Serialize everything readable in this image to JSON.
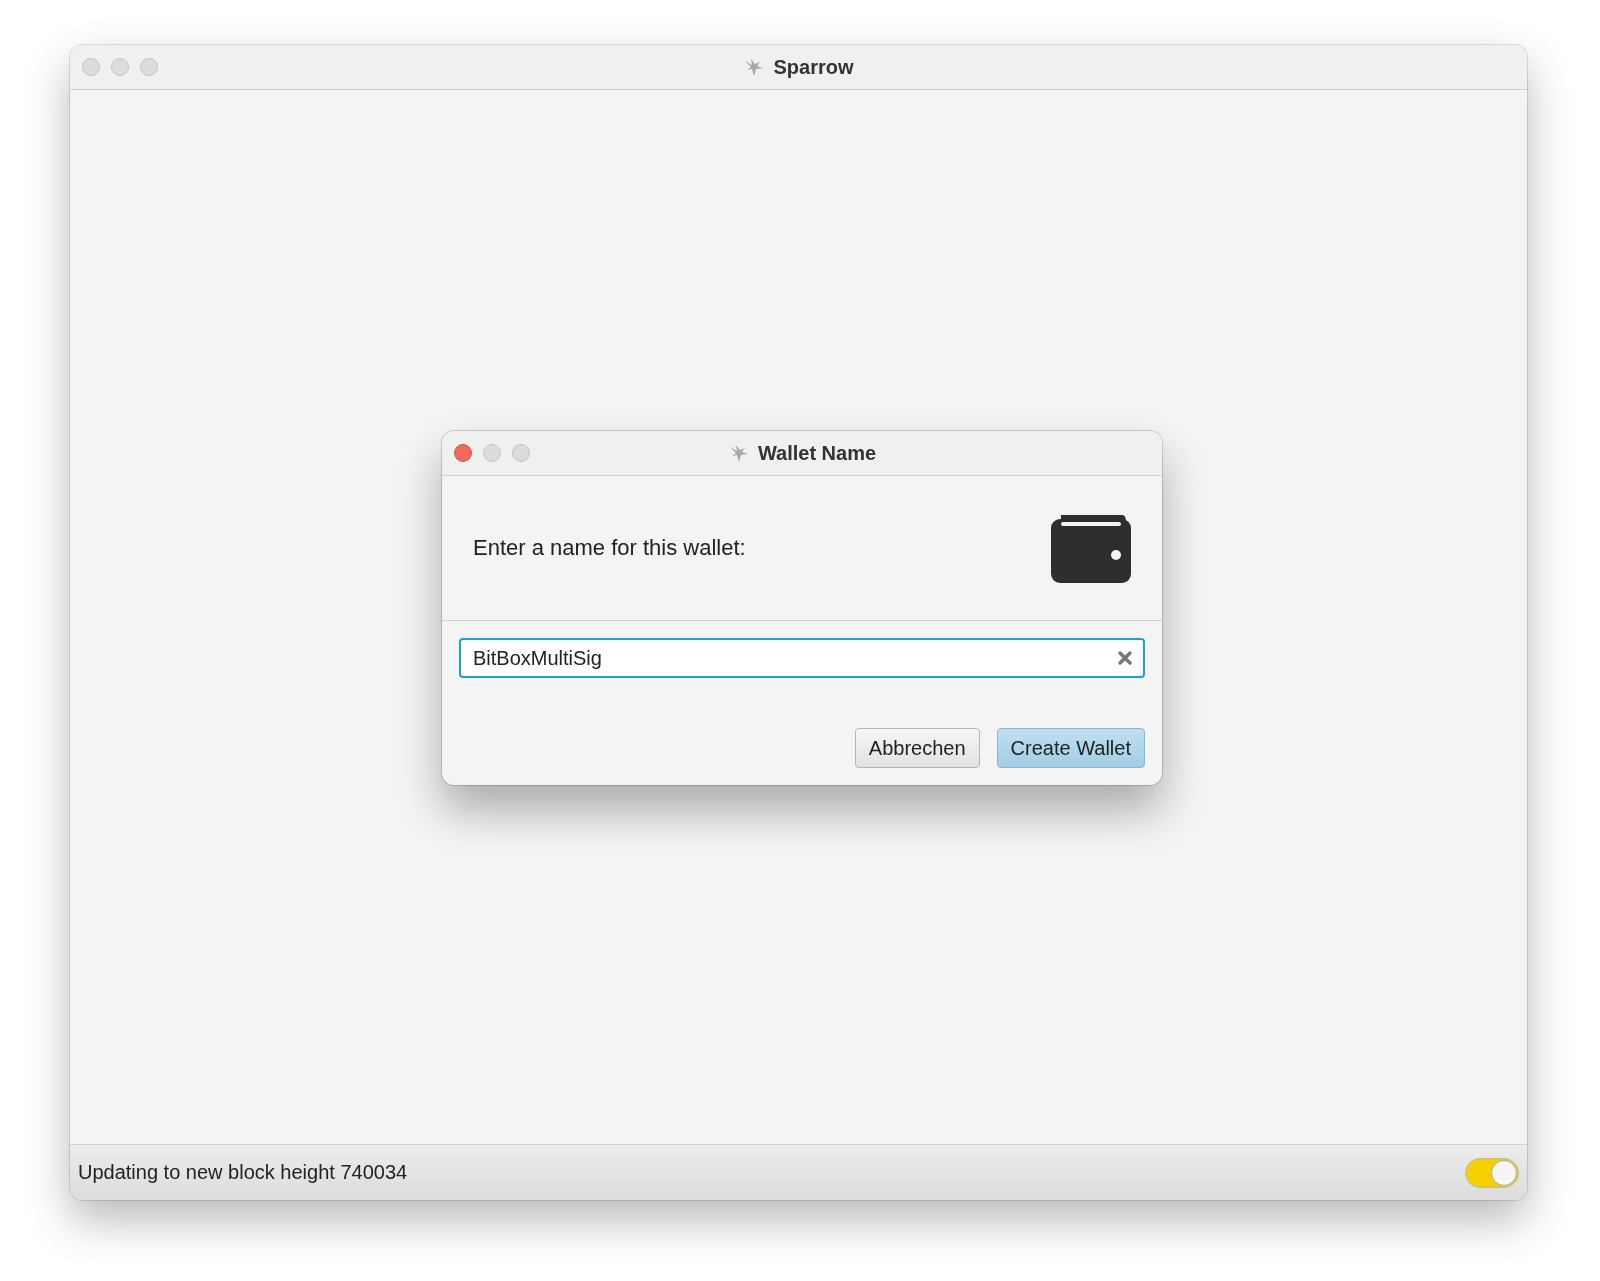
{
  "window": {
    "title": "Sparrow",
    "focused": false
  },
  "dialog": {
    "title": "Wallet Name",
    "focused": true,
    "prompt": "Enter a name for this wallet:",
    "name_field": {
      "value": "BitBoxMultiSig"
    },
    "buttons": [
      {
        "label": "Abbrechen",
        "default": false
      },
      {
        "label": "Create Wallet",
        "default": true
      }
    ]
  },
  "status_bar": {
    "text": "Updating to new block height 740034",
    "toggle": {
      "on": true
    }
  }
}
